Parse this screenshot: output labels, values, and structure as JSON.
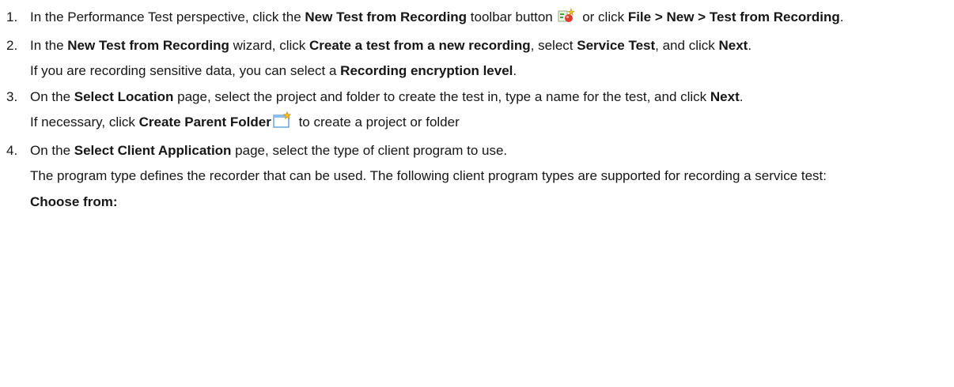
{
  "steps": [
    {
      "num": "1.",
      "s1_pre": "In the Performance Test perspective, click the ",
      "s1_b1": "New Test from Recording",
      "s1_mid": " toolbar button ",
      "s1_or": " or click ",
      "s1_b2": "File > New > Test from Recording",
      "s1_end": "."
    },
    {
      "num": "2.",
      "s2_pre": "In the ",
      "s2_b1": "New Test from Recording",
      "s2_mid1": " wizard, click ",
      "s2_b2": "Create a test from a new recording",
      "s2_mid2": ", select ",
      "s2_b3": "Service Test",
      "s2_mid3": ", and click ",
      "s2_b4": "Next",
      "s2_end": ".",
      "s2_note_pre": "If you are recording sensitive data, you can select a ",
      "s2_note_b": "Recording encryption level",
      "s2_note_end": "."
    },
    {
      "num": "3.",
      "s3_pre": "On the ",
      "s3_b1": "Select Location",
      "s3_mid": " page, select the project and folder to create the test in, type a name for the test, and click ",
      "s3_b2": "Next",
      "s3_end": ".",
      "s3_note_pre": "If necessary, click ",
      "s3_note_b": "Create Parent Folder",
      "s3_note_end": " to create a project or folder"
    },
    {
      "num": "4.",
      "s4_pre": "On the ",
      "s4_b1": "Select Client Application",
      "s4_end": " page, select the type of client program to use.",
      "s4_p2": "The program type defines the recorder that can be used. The following client program types are supported for recording a service test:",
      "s4_choose": "Choose from:"
    }
  ],
  "icons": {
    "new_test_from_recording": "new-test-from-recording-icon",
    "create_parent_folder": "create-parent-folder-icon"
  }
}
